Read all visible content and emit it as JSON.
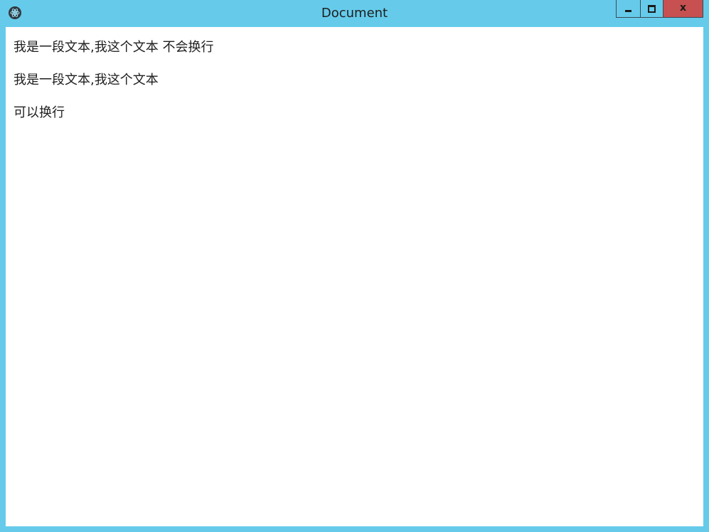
{
  "window": {
    "title": "Document",
    "icon": "electron-icon",
    "close_label": "x"
  },
  "content": {
    "paragraphs": [
      "我是一段文本,我这个文本 不会换行",
      "我是一段文本,我这个文本",
      "可以换行"
    ]
  },
  "colors": {
    "frame": "#66cbeb",
    "close_button": "#c75050",
    "client_background": "#ffffff",
    "text": "#1e1e1e"
  }
}
